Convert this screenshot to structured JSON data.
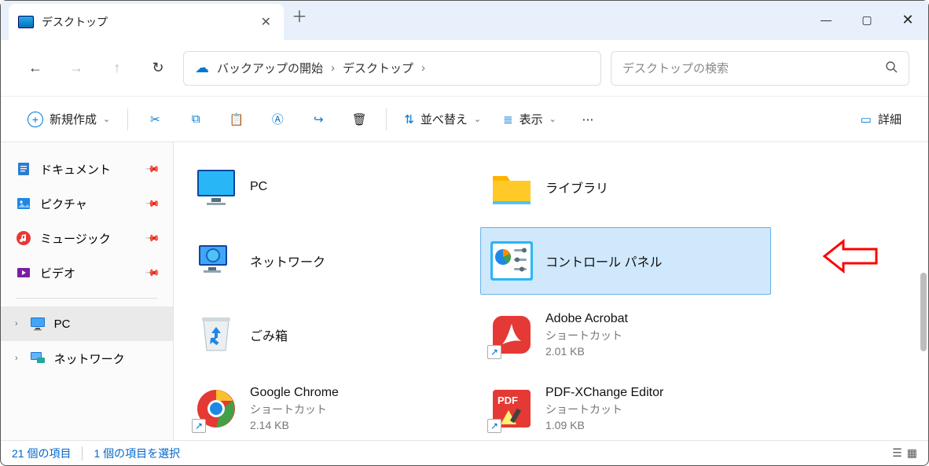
{
  "tab": {
    "title": "デスクトップ"
  },
  "address": {
    "backup_label": "バックアップの開始",
    "crumb": "デスクトップ"
  },
  "search": {
    "placeholder": "デスクトップの検索"
  },
  "toolbar": {
    "new_label": "新規作成",
    "sort_label": "並べ替え",
    "view_label": "表示",
    "detail_label": "詳細"
  },
  "sidebar": {
    "items": [
      {
        "label": "ドキュメント",
        "pinned": true
      },
      {
        "label": "ピクチャ",
        "pinned": true
      },
      {
        "label": "ミュージック",
        "pinned": true
      },
      {
        "label": "ビデオ",
        "pinned": true
      }
    ],
    "pc_label": "PC",
    "network_label": "ネットワーク"
  },
  "items": [
    {
      "name": "PC"
    },
    {
      "name": "ライブラリ"
    },
    {
      "name": "ネットワーク"
    },
    {
      "name": "コントロール パネル",
      "selected": true
    },
    {
      "name": "ごみ箱"
    },
    {
      "name": "Adobe Acrobat",
      "sub1": "ショートカット",
      "sub2": "2.01 KB"
    },
    {
      "name": "Google Chrome",
      "sub1": "ショートカット",
      "sub2": "2.14 KB"
    },
    {
      "name": "PDF-XChange Editor",
      "sub1": "ショートカット",
      "sub2": "1.09 KB"
    }
  ],
  "status": {
    "count_label": "21 個の項目",
    "sel_label": "1 個の項目を選択"
  }
}
